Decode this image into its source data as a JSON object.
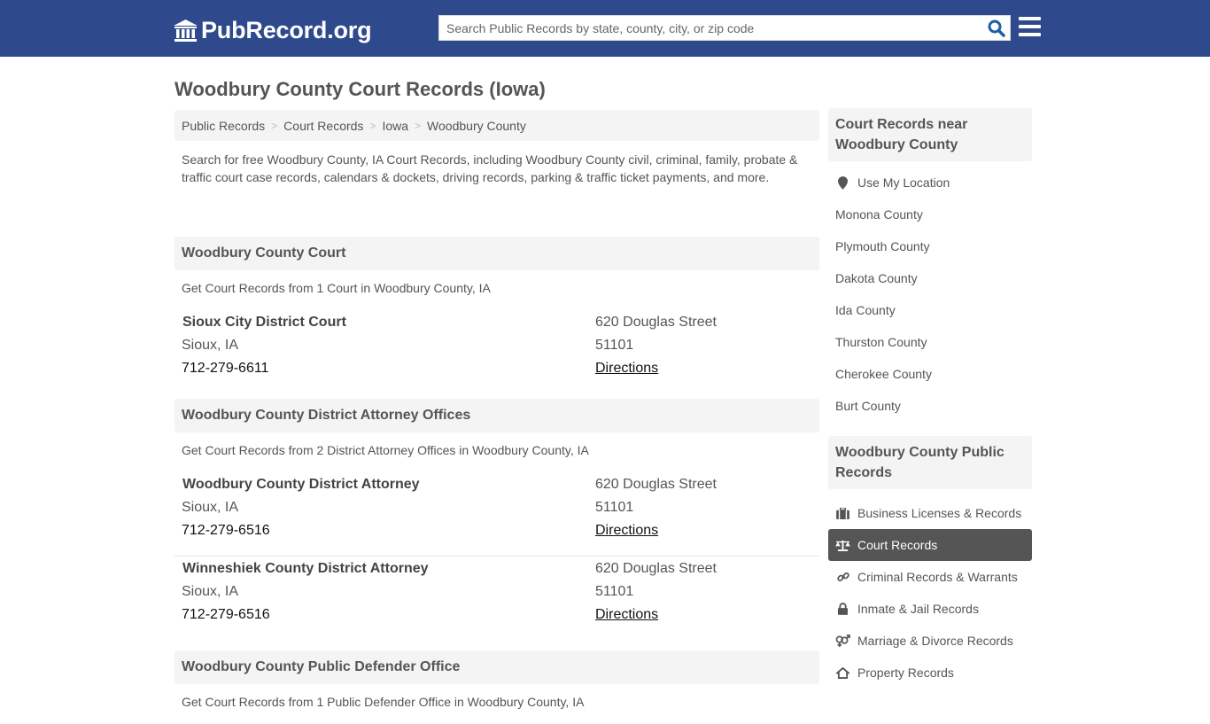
{
  "header": {
    "logo_text": "PubRecord.org",
    "search_placeholder": "Search Public Records by state, county, city, or zip code",
    "search_value": "",
    "search_icon": "search-icon",
    "menu_icon": "hamburger-menu-icon"
  },
  "page": {
    "title": "Woodbury County Court Records (Iowa)",
    "breadcrumb": [
      "Public Records",
      "Court Records",
      "Iowa",
      "Woodbury County"
    ],
    "intro": "Search for free Woodbury County, IA Court Records, including Woodbury County civil, criminal, family, probate & traffic court case records, calendars & dockets, driving records, parking & traffic ticket payments, and more."
  },
  "sections": [
    {
      "title": "Woodbury County Court",
      "subtitle": "Get Court Records from 1 Court in Woodbury County, IA",
      "entries": [
        {
          "name": "Sioux City District Court",
          "city": "Sioux, IA",
          "phone": "712-279-6611",
          "street": "620 Douglas Street",
          "zip": "51101",
          "directions": "Directions"
        }
      ]
    },
    {
      "title": "Woodbury County District Attorney Offices",
      "subtitle": "Get Court Records from 2 District Attorney Offices in Woodbury County, IA",
      "entries": [
        {
          "name": "Woodbury County District Attorney",
          "city": "Sioux, IA",
          "phone": "712-279-6516",
          "street": "620 Douglas Street",
          "zip": "51101",
          "directions": "Directions"
        },
        {
          "name": "Winneshiek County District Attorney",
          "city": "Sioux, IA",
          "phone": "712-279-6516",
          "street": "620 Douglas Street",
          "zip": "51101",
          "directions": "Directions"
        }
      ]
    },
    {
      "title": "Woodbury County Public Defender Office",
      "subtitle": "Get Court Records from 1 Public Defender Office in Woodbury County, IA",
      "entries": []
    }
  ],
  "sidebar": {
    "nearby": {
      "title": "Court Records near Woodbury County",
      "use_location": "Use My Location",
      "counties": [
        "Monona County",
        "Plymouth County",
        "Dakota County",
        "Ida County",
        "Thurston County",
        "Cherokee County",
        "Burt County"
      ]
    },
    "public_records": {
      "title": "Woodbury County Public Records",
      "items": [
        {
          "label": "Business Licenses & Records",
          "icon": "briefcase-icon",
          "active": false
        },
        {
          "label": "Court Records",
          "icon": "balance-scale-icon",
          "active": true
        },
        {
          "label": "Criminal Records & Warrants",
          "icon": "link-icon",
          "active": false
        },
        {
          "label": "Inmate & Jail Records",
          "icon": "lock-icon",
          "active": false
        },
        {
          "label": "Marriage & Divorce Records",
          "icon": "gender-icon",
          "active": false
        },
        {
          "label": "Property Records",
          "icon": "home-icon",
          "active": false
        }
      ]
    }
  },
  "colors": {
    "header_bg": "#2e4a8d",
    "search_icon": "#1e5fa8",
    "panel_bg": "#f4f4f4",
    "active_item_bg": "#555555",
    "text": "#555555"
  }
}
